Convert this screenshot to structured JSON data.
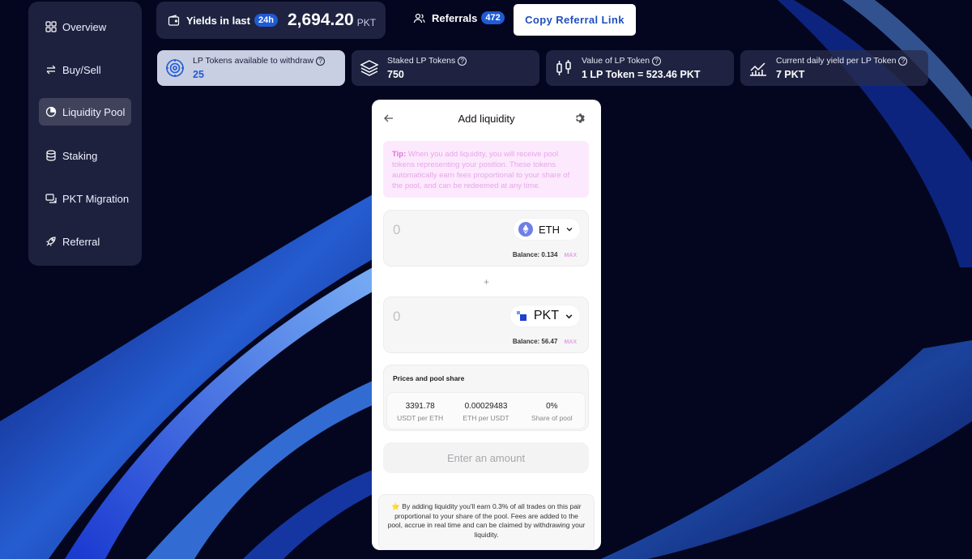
{
  "colors": {
    "accent": "#1f5bd6",
    "page_bg": "#04061f",
    "tip_bg": "#fde9fd",
    "tip_accent": "#e36fdc"
  },
  "sidebar": {
    "items": [
      {
        "label": "Overview",
        "icon": "grid-icon"
      },
      {
        "label": "Buy/Sell",
        "icon": "swap-arrows-icon"
      },
      {
        "label": "Liquidity Pool",
        "icon": "pie-chart-icon",
        "active": true
      },
      {
        "label": "Staking",
        "icon": "database-stack-icon"
      },
      {
        "label": "PKT Migration",
        "icon": "migration-icon"
      },
      {
        "label": "Referral",
        "icon": "rocket-icon"
      }
    ]
  },
  "header": {
    "yields_label": "Yields in last",
    "yields_period": "24h",
    "yields_value": "2,694.20",
    "yields_unit": "PKT",
    "referrals_label": "Referrals",
    "referrals_count": "472",
    "copy_referral_label": "Copy Referral Link"
  },
  "stats": [
    {
      "label": "LP Tokens available to withdraw",
      "value": "25",
      "icon": "target-icon"
    },
    {
      "label": "Staked LP Tokens",
      "value": "750",
      "icon": "layers-icon"
    },
    {
      "label": "Value of LP Token",
      "value": "1 LP Token = 523.46 PKT",
      "icon": "candlestick-icon"
    },
    {
      "label": "Current daily yield per LP Token",
      "value": "7 PKT",
      "icon": "trend-chart-icon"
    }
  ],
  "modal": {
    "title": "Add liquidity",
    "tip_prefix": "Tip:",
    "tip_text": " When you add liquidity, you will receive pool tokens representing your position. These tokens automatically earn fees proportional to your share of the pool, and can be redeemed at any time.",
    "token_a": {
      "placeholder": "0",
      "symbol": "ETH",
      "balance": "Balance: 0.134",
      "max_label": "MAX"
    },
    "plus": "+",
    "token_b": {
      "placeholder": "0",
      "symbol": "PKT",
      "balance": "Balance: 56.47",
      "max_label": "MAX"
    },
    "prices_title": "Prices and pool share",
    "prices": [
      {
        "value": "3391.78",
        "label": "USDT per ETH"
      },
      {
        "value": "0.00029483",
        "label": "ETH per USDT"
      },
      {
        "value": "0%",
        "label": "Share of pool"
      }
    ],
    "enter_button": "Enter an amount",
    "footer_note": "⭐ By adding liquidity you'll earn 0.3% of all trades on this pair proportional to your share of the pool. Fees are added to the pool, accrue in real time and can be claimed by withdrawing your liquidity."
  }
}
